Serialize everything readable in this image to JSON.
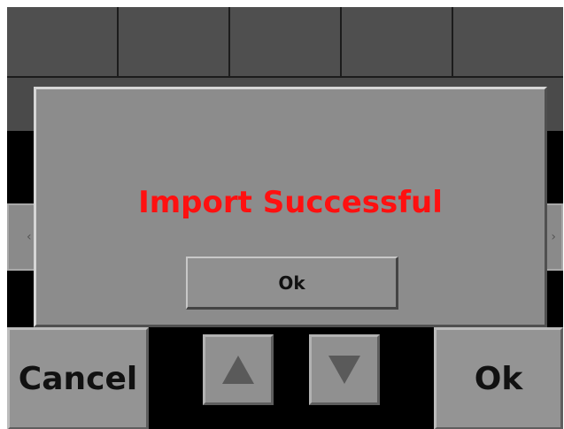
{
  "top_tabs": [
    "",
    "",
    "",
    "",
    ""
  ],
  "side_arrows": {
    "left": "‹",
    "right": "›"
  },
  "bottom_bar": {
    "cancel_label": "Cancel",
    "ok_label": "Ok",
    "up_icon": "arrow-up-icon",
    "down_icon": "arrow-down-icon"
  },
  "dialog": {
    "message": "Import Successful",
    "ok_label": "Ok"
  },
  "colors": {
    "message": "#ff1010",
    "dialog_bg": "#8c8c8c",
    "button_bg": "#949494",
    "screen_bg": "#000000"
  }
}
